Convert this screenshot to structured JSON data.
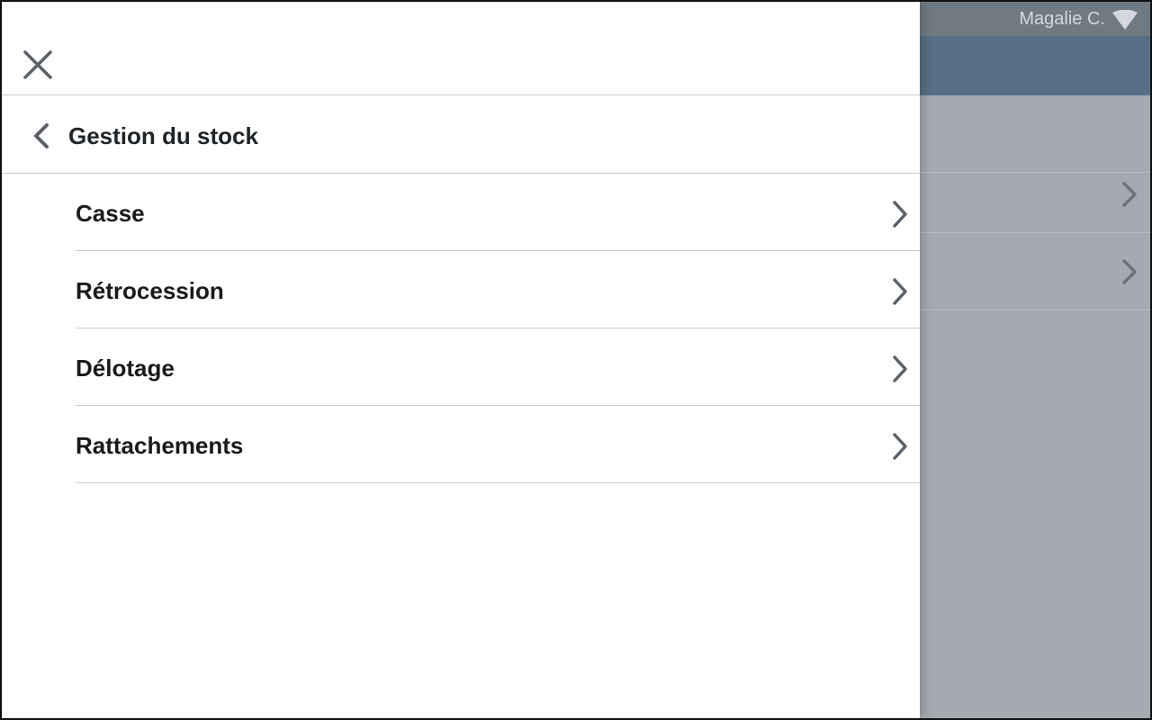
{
  "status_bar": {
    "user_name": "Magalie C.",
    "wifi_icon": "wifi-icon"
  },
  "drawer": {
    "close_icon": "close-icon",
    "section": {
      "back_icon": "chevron-left-icon",
      "title": "Gestion du stock"
    },
    "items": [
      {
        "label": "Casse",
        "icon": "chevron-right-icon"
      },
      {
        "label": "Rétrocession",
        "icon": "chevron-right-icon"
      },
      {
        "label": "Délotage",
        "icon": "chevron-right-icon"
      },
      {
        "label": "Rattachements",
        "icon": "chevron-right-icon"
      }
    ]
  },
  "background_app": {
    "row_count": 2,
    "row_icon": "chevron-right-icon"
  },
  "colors": {
    "status_bar": "#6f7a82",
    "header": "#576f86",
    "overlay": "#a5a9b0",
    "drawer_bg": "#ffffff",
    "divider": "#c8ced2",
    "icon": "#5a6168",
    "text": "#1a1a1a"
  }
}
